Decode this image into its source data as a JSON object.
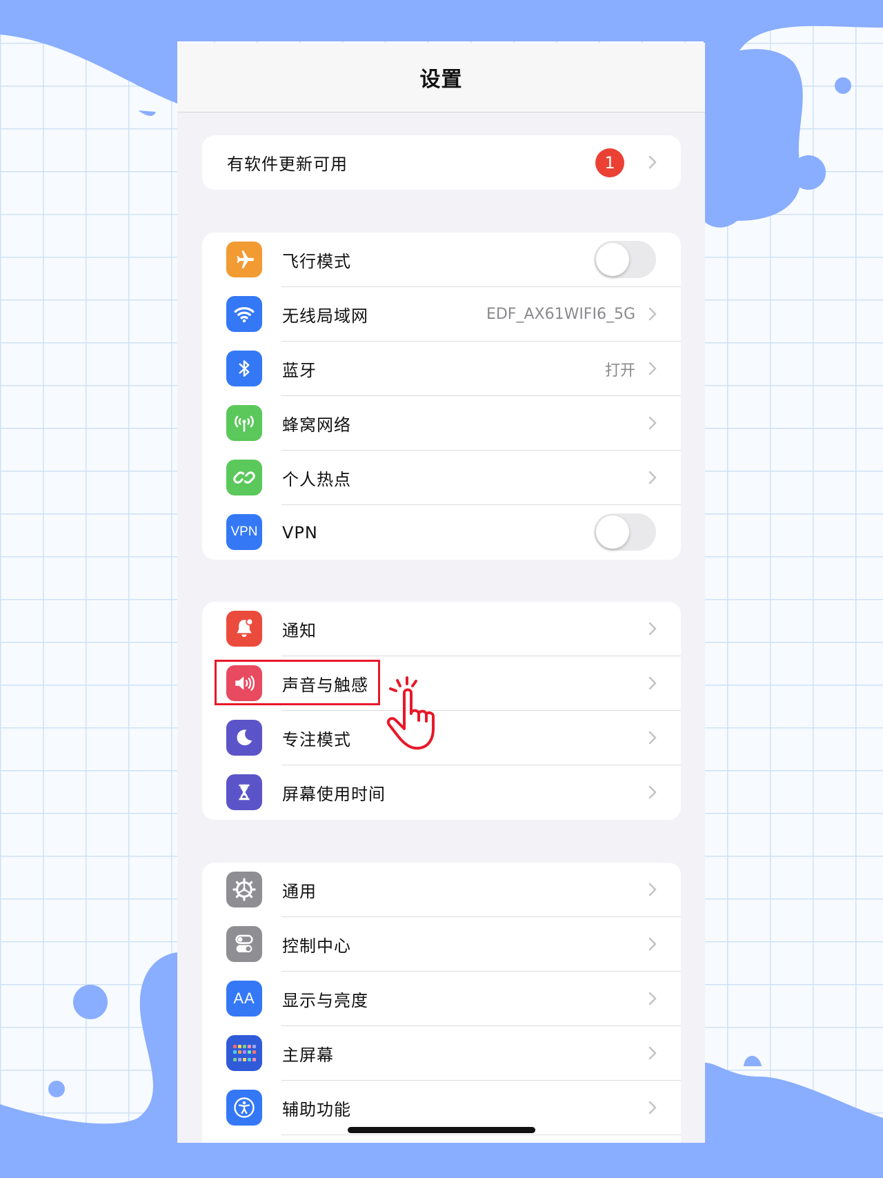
{
  "colors": {
    "decor_blue": "#89adff",
    "grid_line": "#cfe0f5",
    "highlight_red": "#e8182a",
    "badge_red": "#eb4034"
  },
  "nav": {
    "title": "设置"
  },
  "update_group": {
    "label": "有软件更新可用",
    "badge": "1"
  },
  "network_group": [
    {
      "label": "飞行模式",
      "icon": "airplane-icon",
      "icon_color": "#f29b33",
      "control": "toggle",
      "on": false
    },
    {
      "label": "无线局域网",
      "icon": "wifi-icon",
      "icon_color": "#3478f6",
      "value": "EDF_AX61WIFI6_5G"
    },
    {
      "label": "蓝牙",
      "icon": "bluetooth-icon",
      "icon_color": "#3478f6",
      "value": "打开"
    },
    {
      "label": "蜂窝网络",
      "icon": "cellular-antenna-icon",
      "icon_color": "#5ac85a"
    },
    {
      "label": "个人热点",
      "icon": "hotspot-link-icon",
      "icon_color": "#5ac85a"
    },
    {
      "label": "VPN",
      "icon": "vpn-icon",
      "icon_color": "#3478f6",
      "icon_text": "VPN",
      "control": "toggle",
      "on": false
    }
  ],
  "notify_group": [
    {
      "label": "通知",
      "icon": "bell-icon",
      "icon_color": "#eb4b3d"
    },
    {
      "label": "声音与触感",
      "icon": "speaker-icon",
      "icon_color": "#e84a5f",
      "highlighted": true
    },
    {
      "label": "专注模式",
      "icon": "moon-icon",
      "icon_color": "#5b54c9"
    },
    {
      "label": "屏幕使用时间",
      "icon": "hourglass-icon",
      "icon_color": "#5b54c9"
    }
  ],
  "general_group": [
    {
      "label": "通用",
      "icon": "gear-icon",
      "icon_color": "#8e8e93"
    },
    {
      "label": "控制中心",
      "icon": "switches-icon",
      "icon_color": "#8e8e93"
    },
    {
      "label": "显示与亮度",
      "icon": "text-size-icon",
      "icon_color": "#3478f6",
      "icon_text": "AA"
    },
    {
      "label": "主屏幕",
      "icon": "home-screen-grid-icon",
      "icon_color": "#2f5bd9"
    },
    {
      "label": "辅助功能",
      "icon": "accessibility-icon",
      "icon_color": "#3478f6"
    }
  ]
}
